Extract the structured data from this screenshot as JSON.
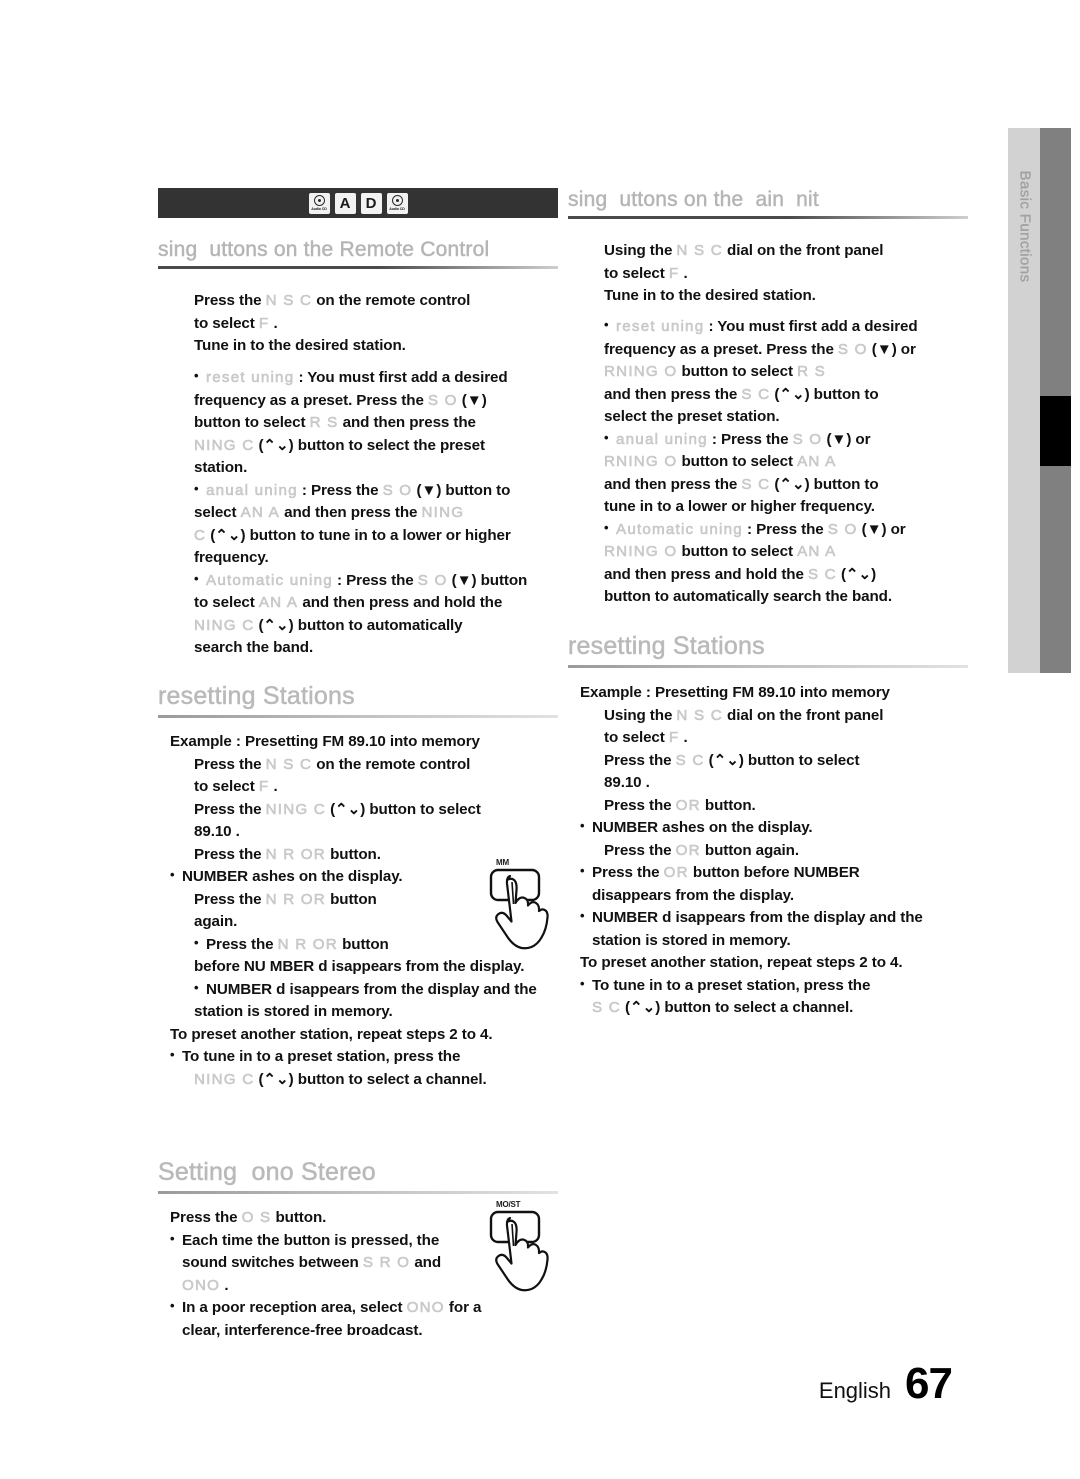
{
  "sidebar": {
    "tab_label": "Basic Functions"
  },
  "media_bar": {
    "badges": [
      {
        "type": "disc",
        "caption": "Audio CD"
      },
      {
        "type": "letter",
        "label": "A"
      },
      {
        "type": "letter",
        "label": "D"
      },
      {
        "type": "disc",
        "caption": "Audio CD"
      }
    ]
  },
  "left_column": {
    "heading_remote": "sing  uttons on the Remote Control",
    "remote_steps": {
      "l1_a": "Press the ",
      "l1_ghost": "N   S   C",
      "l1_b": "  on the remote control",
      "l2_a": "to select ",
      "l2_ghost": "F",
      "l2_b": " .",
      "l3": "Tune in to the desired station."
    },
    "bullets_remote": [
      {
        "ghost_title": "reset  uning",
        "lines": [
          {
            "segs": [
              {
                "t": "plain",
                "v": "  : You must first add a desired"
              }
            ]
          },
          {
            "segs": [
              {
                "t": "plain",
                "v": "frequency as a preset. Press the "
              },
              {
                "t": "ghost",
                "v": "S O"
              },
              {
                "t": "plain",
                "v": "  (▼)"
              }
            ]
          },
          {
            "segs": [
              {
                "t": "plain",
                "v": "button to select "
              },
              {
                "t": "ghost",
                "v": "R S"
              },
              {
                "t": "plain",
                "v": "   and then press the"
              }
            ]
          },
          {
            "segs": [
              {
                "t": "ghost",
                "v": "NING C"
              },
              {
                "t": "plain",
                "v": "  (⌃⌄) button to select the preset"
              }
            ]
          },
          {
            "segs": [
              {
                "t": "plain",
                "v": "station."
              }
            ]
          }
        ]
      },
      {
        "ghost_title": "anual  uning",
        "lines": [
          {
            "segs": [
              {
                "t": "plain",
                "v": " : Press the "
              },
              {
                "t": "ghost",
                "v": "S O"
              },
              {
                "t": "plain",
                "v": "  (▼) button to"
              }
            ]
          },
          {
            "segs": [
              {
                "t": "plain",
                "v": "select "
              },
              {
                "t": "ghost",
                "v": "AN A"
              },
              {
                "t": "plain",
                "v": "   and then press the "
              },
              {
                "t": "ghost",
                "v": "NING"
              }
            ]
          },
          {
            "segs": [
              {
                "t": "ghost",
                "v": "C"
              },
              {
                "t": "plain",
                "v": "  (⌃⌄) button to tune in to a lower or higher"
              }
            ]
          },
          {
            "segs": [
              {
                "t": "plain",
                "v": "frequency."
              }
            ]
          }
        ]
      },
      {
        "ghost_title": "Automatic  uning",
        "lines": [
          {
            "segs": [
              {
                "t": "plain",
                "v": " : Press the "
              },
              {
                "t": "ghost",
                "v": "S O"
              },
              {
                "t": "plain",
                "v": "  (▼) button"
              }
            ]
          },
          {
            "segs": [
              {
                "t": "plain",
                "v": "to select "
              },
              {
                "t": "ghost",
                "v": "AN A"
              },
              {
                "t": "plain",
                "v": "   and then press and hold the"
              }
            ]
          },
          {
            "segs": [
              {
                "t": "ghost",
                "v": "NING C"
              },
              {
                "t": "plain",
                "v": "  (⌃⌄) button to automatically"
              }
            ]
          },
          {
            "segs": [
              {
                "t": "plain",
                "v": "search the band."
              }
            ]
          }
        ]
      }
    ],
    "heading_presetting": "resetting Stations",
    "example_line": "Example : Presetting FM 89.10 into memory",
    "preset_steps": {
      "s1_a": "Press the ",
      "s1_ghost": "N   S   C",
      "s1_b": "   on the remote control",
      "s1_c": "to select ",
      "s1_ghost2": "F",
      "s1_d": " .",
      "s2_a": "Press the  ",
      "s2_ghost": "NING C",
      "s2_b": "   (⌃⌄) button to select",
      "s2_c": " 89.10 .",
      "s3_a": "Press the  ",
      "s3_ghost": "N R   OR",
      "s3_b": "          button.",
      "s3_note": "NUMBER  ashes on the display.",
      "s4_a": "Press the  ",
      "s4_ghost": "N R   OR",
      "s4_b": "          button",
      "s4_c": "again.",
      "s5_a": "Press the  ",
      "s5_ghost": "N R   OR",
      "s5_b": "           button",
      "s5_c": "before NU  MBER d  isappears from the display.",
      "s6_a": "NUMBER d   isappears from the display and the",
      "s6_b": "station is stored in memory.",
      "s7": "To preset another station, repeat steps 2 to 4.",
      "s8_a": "To tune in to a preset station, press the",
      "s8_ghost": "NING C",
      "s8_b": "   (⌃⌄) button  to select a channel."
    },
    "hand_button_label": "MM",
    "heading_mono": "Setting  ono Stereo",
    "mono_steps": {
      "m1_a": "Press the  ",
      "m1_ghost": "O S",
      "m1_b": "    button.",
      "m2_a": "Each time the button is pressed, the",
      "m2_b": "sound switches between ",
      "m2_ghost": "S R O",
      "m2_c": "   and",
      "m2_ghost2": "ONO",
      "m2_d": " .",
      "m3_a": "In a poor reception area, select ",
      "m3_ghost": "ONO",
      "m3_b": "  for a",
      "m3_c": "clear, interference-free broadcast."
    },
    "mono_hand_button_label": "MO/ST"
  },
  "right_column": {
    "heading_main_unit": "sing  uttons on the  ain  nit",
    "main_unit_steps": {
      "l1_a": "Using the ",
      "l1_ghost": "N   S   C",
      "l1_b": "       dial on the front panel",
      "l2_a": "to select ",
      "l2_ghost": "F",
      "l2_b": " .",
      "l3": "Tune in to the desired station."
    },
    "bullets_main": [
      {
        "ghost_title": "reset  uning",
        "lines": [
          {
            "segs": [
              {
                "t": "plain",
                "v": "  : You must first add a desired"
              }
            ]
          },
          {
            "segs": [
              {
                "t": "plain",
                "v": "frequency as a preset. Press the "
              },
              {
                "t": "ghost",
                "v": "S O"
              },
              {
                "t": "plain",
                "v": "  (▼) or"
              }
            ]
          },
          {
            "segs": [
              {
                "t": "ghost",
                "v": "RNING O"
              },
              {
                "t": "plain",
                "v": "     button to select "
              },
              {
                "t": "ghost",
                "v": "R S"
              }
            ]
          },
          {
            "segs": [
              {
                "t": "plain",
                "v": "and then press the "
              },
              {
                "t": "ghost",
                "v": "S  C"
              },
              {
                "t": "plain",
                "v": "   (⌃⌄) button to"
              }
            ]
          },
          {
            "segs": [
              {
                "t": "plain",
                "v": "select the preset station."
              }
            ]
          }
        ]
      },
      {
        "ghost_title": "anual  uning",
        "lines": [
          {
            "segs": [
              {
                "t": "plain",
                "v": " : Press the "
              },
              {
                "t": "ghost",
                "v": "S O"
              },
              {
                "t": "plain",
                "v": "  (▼) or"
              }
            ]
          },
          {
            "segs": [
              {
                "t": "ghost",
                "v": "RNING O"
              },
              {
                "t": "plain",
                "v": "     button to select "
              },
              {
                "t": "ghost",
                "v": "AN A"
              }
            ]
          },
          {
            "segs": [
              {
                "t": "plain",
                "v": "and then press the "
              },
              {
                "t": "ghost",
                "v": "S  C"
              },
              {
                "t": "plain",
                "v": "   (⌃⌄) button to"
              }
            ]
          },
          {
            "segs": [
              {
                "t": "plain",
                "v": "tune in to a lower or higher frequency."
              }
            ]
          }
        ]
      },
      {
        "ghost_title": "Automatic  uning",
        "lines": [
          {
            "segs": [
              {
                "t": "plain",
                "v": " : Press the "
              },
              {
                "t": "ghost",
                "v": "S O"
              },
              {
                "t": "plain",
                "v": "  (▼) or"
              }
            ]
          },
          {
            "segs": [
              {
                "t": "ghost",
                "v": "RNING O"
              },
              {
                "t": "plain",
                "v": "     button to select "
              },
              {
                "t": "ghost",
                "v": "AN A"
              }
            ]
          },
          {
            "segs": [
              {
                "t": "plain",
                "v": "and then press and hold the "
              },
              {
                "t": "ghost",
                "v": "S  C"
              },
              {
                "t": "plain",
                "v": "   (⌃⌄)"
              }
            ]
          },
          {
            "segs": [
              {
                "t": "plain",
                "v": "button to automatically search the band."
              }
            ]
          }
        ]
      }
    ],
    "heading_presetting": "resetting Stations",
    "example_line": "Example : Presetting FM 89.10 into memory",
    "preset_steps": {
      "s1_a": "Using the ",
      "s1_ghost": "N   S   C",
      "s1_b": "       dial on the front panel",
      "s1_c": "to select ",
      "s1_ghost2": "F",
      "s1_d": " .",
      "s2_a": "Press the ",
      "s2_ghost": "S  C",
      "s2_b": "   (⌃⌄) button to select",
      "s2_c": " 89.10 .",
      "s3_a": "Press the  ",
      "s3_ghost": "OR",
      "s3_b": "      button.",
      "s3_note": "NUMBER  ashes on the display.",
      "s4_a": "Press the  ",
      "s4_ghost": "OR",
      "s4_b": "      button again.",
      "s5_a": "Press the  ",
      "s5_ghost": "OR",
      "s5_b": "      button before   NUMBER",
      "s5_c": "disappears from the display.",
      "s6_a": "NUMBER d   isappears from the display and the",
      "s6_b": "station is stored in memory.",
      "s7": "To preset another station, repeat steps 2 to 4.",
      "s8_a": "To tune in to a preset station, press the",
      "s8_ghost": "S  C",
      "s8_b": "   (⌃⌄) button  to select a channel."
    }
  },
  "footer": {
    "language": "English",
    "page_number": "67"
  },
  "colors": {
    "ghost_text": "#cccccc",
    "heading": "#b4b4b4",
    "media_bar_bg": "#333333",
    "sidebar_light": "#d2d2d2",
    "sidebar_dark": "#808080",
    "sidebar_marker": "#000000"
  }
}
